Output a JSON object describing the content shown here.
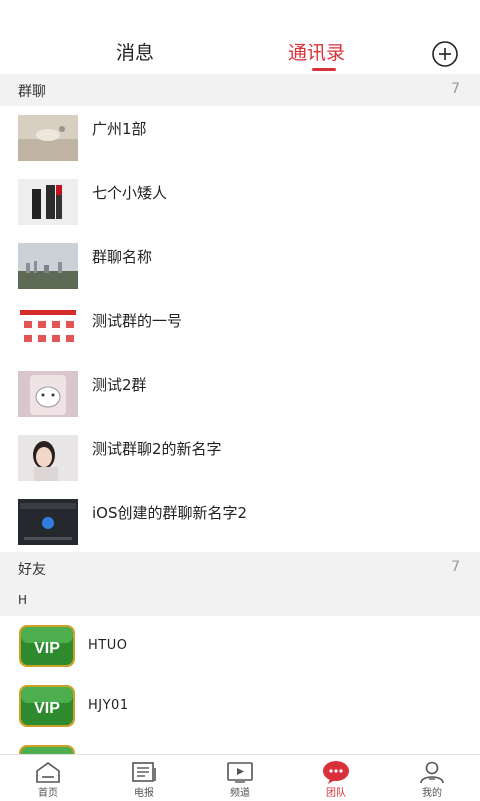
{
  "header": {
    "tab_messages": "消息",
    "tab_contacts": "通讯录",
    "accent": "#d9313a"
  },
  "groups": {
    "title": "群聊",
    "count": "7",
    "items": [
      {
        "label": "广州1部"
      },
      {
        "label": "七个小矮人"
      },
      {
        "label": "群聊名称"
      },
      {
        "label": "测试群的一号"
      },
      {
        "label": "测试2群"
      },
      {
        "label": "测试群聊2的新名字"
      },
      {
        "label": "iOS创建的群聊新名字2"
      }
    ]
  },
  "friends": {
    "title": "好友",
    "count": "7",
    "index_letter": "H",
    "badge_text": "VIP",
    "items": [
      {
        "label": "HTUO"
      },
      {
        "label": "HJY01"
      }
    ]
  },
  "bottom_nav": [
    {
      "label": "首页",
      "icon": "home-icon"
    },
    {
      "label": "电报",
      "icon": "newspaper-icon"
    },
    {
      "label": "频道",
      "icon": "video-play-icon"
    },
    {
      "label": "团队",
      "icon": "chat-bubble-icon"
    },
    {
      "label": "我的",
      "icon": "user-icon"
    }
  ]
}
